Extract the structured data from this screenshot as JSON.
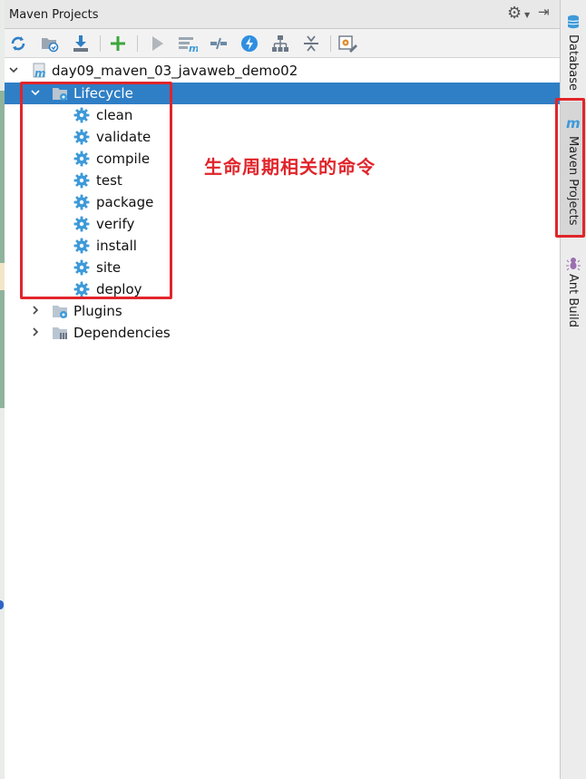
{
  "panel": {
    "title": "Maven Projects",
    "gear_icon": "gear-icon",
    "hide_icon": "hide-panel-icon"
  },
  "toolbar": {
    "buttons": [
      {
        "name": "reimport-all-projects",
        "icon": "refresh-icon"
      },
      {
        "name": "generate-sources",
        "icon": "folder-sync-icon"
      },
      {
        "name": "download-sources",
        "icon": "download-icon"
      },
      {
        "name": "add-maven-project",
        "icon": "plus-icon"
      },
      {
        "name": "run-maven-build",
        "icon": "play-icon"
      },
      {
        "name": "execute-maven-goal",
        "icon": "maven-goal-icon"
      },
      {
        "name": "toggle-offline-mode",
        "icon": "offline-icon"
      },
      {
        "name": "toggle-skip-tests",
        "icon": "lightning-icon"
      },
      {
        "name": "show-dependencies",
        "icon": "hierarchy-icon"
      },
      {
        "name": "collapse-all",
        "icon": "collapse-icon"
      },
      {
        "name": "maven-settings",
        "icon": "settings-wrench-icon"
      }
    ]
  },
  "tree": {
    "project": "day09_maven_03_javaweb_demo02",
    "lifecycle": {
      "label": "Lifecycle",
      "phases": [
        "clean",
        "validate",
        "compile",
        "test",
        "package",
        "verify",
        "install",
        "site",
        "deploy"
      ]
    },
    "plugins": "Plugins",
    "dependencies": "Dependencies"
  },
  "annotation": {
    "text": "生命周期相关的命令",
    "color": "#e0252b"
  },
  "sidebar": {
    "tabs": [
      {
        "label": "Database",
        "icon": "database-icon"
      },
      {
        "label": "Maven Projects",
        "icon": "maven-icon",
        "active": true
      },
      {
        "label": "Ant Build",
        "icon": "ant-icon"
      }
    ]
  },
  "colors": {
    "selection": "#2f7fc6",
    "gear_blue": "#3d9ad9",
    "annotation_red": "#e0252b"
  }
}
